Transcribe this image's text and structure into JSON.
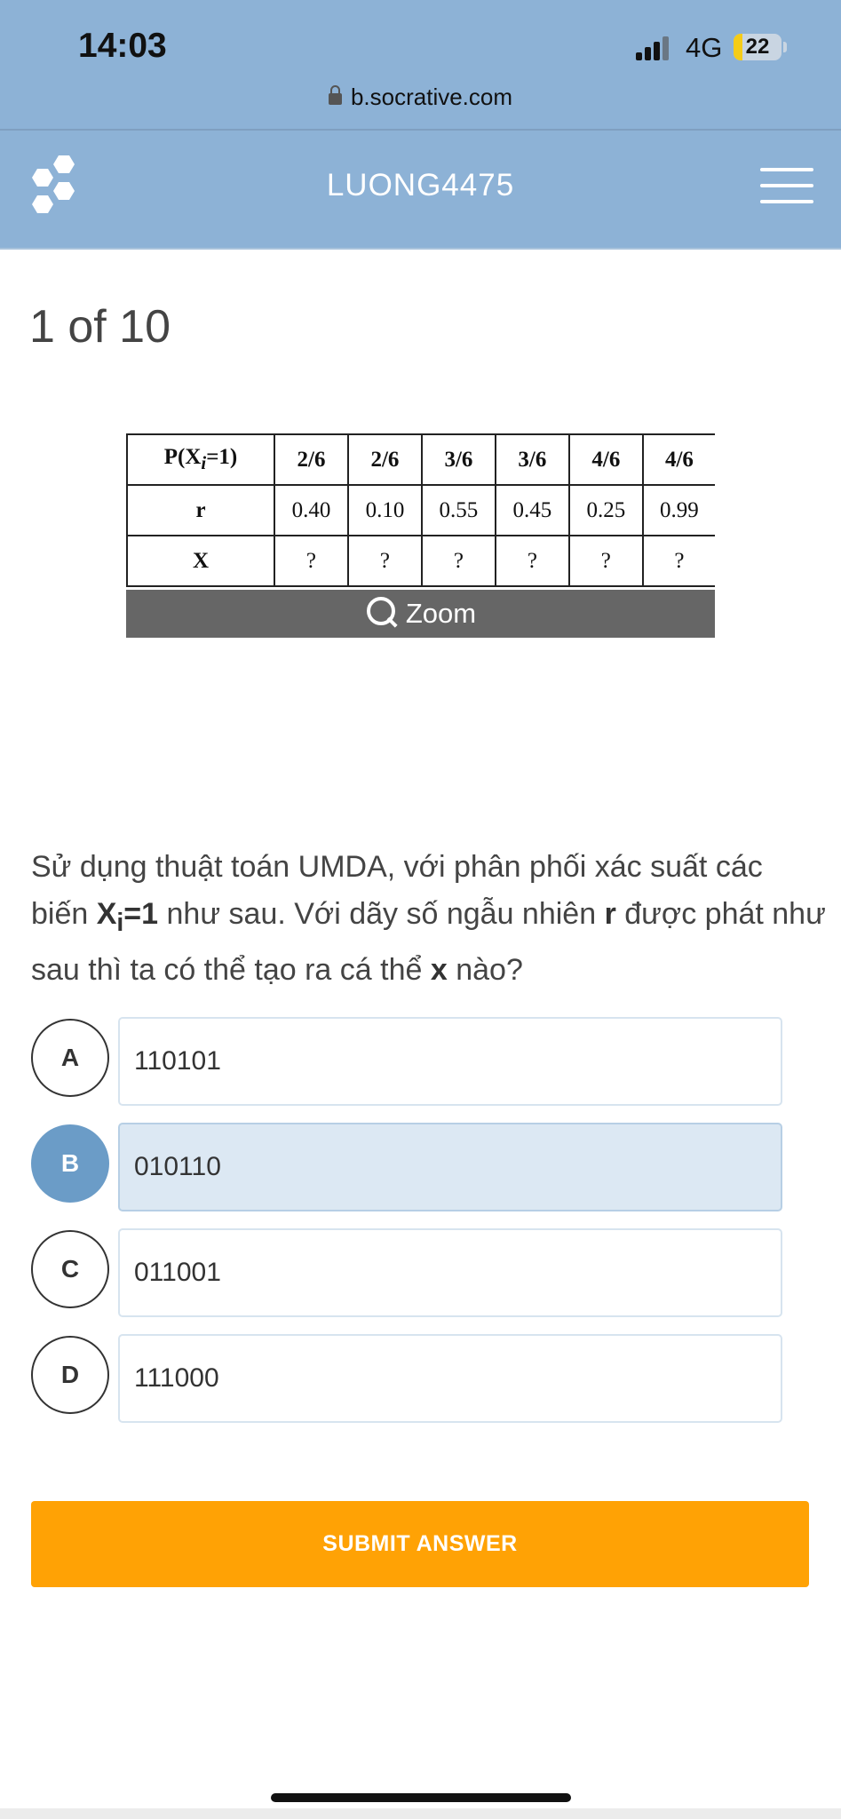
{
  "status_bar": {
    "time": "14:03",
    "network": "4G",
    "battery_level": "22",
    "battery_fraction": 0.22
  },
  "browser": {
    "url": "b.socrative.com"
  },
  "header": {
    "room_name": "LUONG4475",
    "logo_icon": "socrative-logo-icon",
    "menu_icon": "hamburger-menu-icon"
  },
  "question": {
    "counter": "1 of 10",
    "image_table": {
      "row_headers": [
        "P(X",
        "i",
        "=1)",
        "r",
        "X"
      ],
      "probabilities": [
        "2/6",
        "2/6",
        "3/6",
        "3/6",
        "4/6",
        "4/6"
      ],
      "r_values": [
        "0.40",
        "0.10",
        "0.55",
        "0.45",
        "0.25",
        "0.99"
      ],
      "x_values": [
        "?",
        "?",
        "?",
        "?",
        "?",
        "?"
      ]
    },
    "zoom_label": "Zoom",
    "text_parts": {
      "p1": "Sử dụng thuật toán UMDA, với phân phối xác suất các biến ",
      "var_x": "X",
      "var_sub": "i",
      "var_eq": "=1",
      "p2": " như sau. Với dãy số ngẫu nhiên ",
      "var_r": "r",
      "p3": " được phát như sau thì ta có thể tạo ra cá thể ",
      "var_x2": "x",
      "p4": " nào?"
    },
    "options": [
      {
        "letter": "A",
        "text": "110101",
        "selected": false
      },
      {
        "letter": "B",
        "text": "010110",
        "selected": true
      },
      {
        "letter": "C",
        "text": "011001",
        "selected": false
      },
      {
        "letter": "D",
        "text": "111000",
        "selected": false
      }
    ],
    "submit_label": "SUBMIT ANSWER"
  },
  "colors": {
    "header_bg": "#8db2d6",
    "selected_letter": "#6b9cc7",
    "selected_box": "#dce8f3",
    "submit_bg": "#ffa205"
  }
}
